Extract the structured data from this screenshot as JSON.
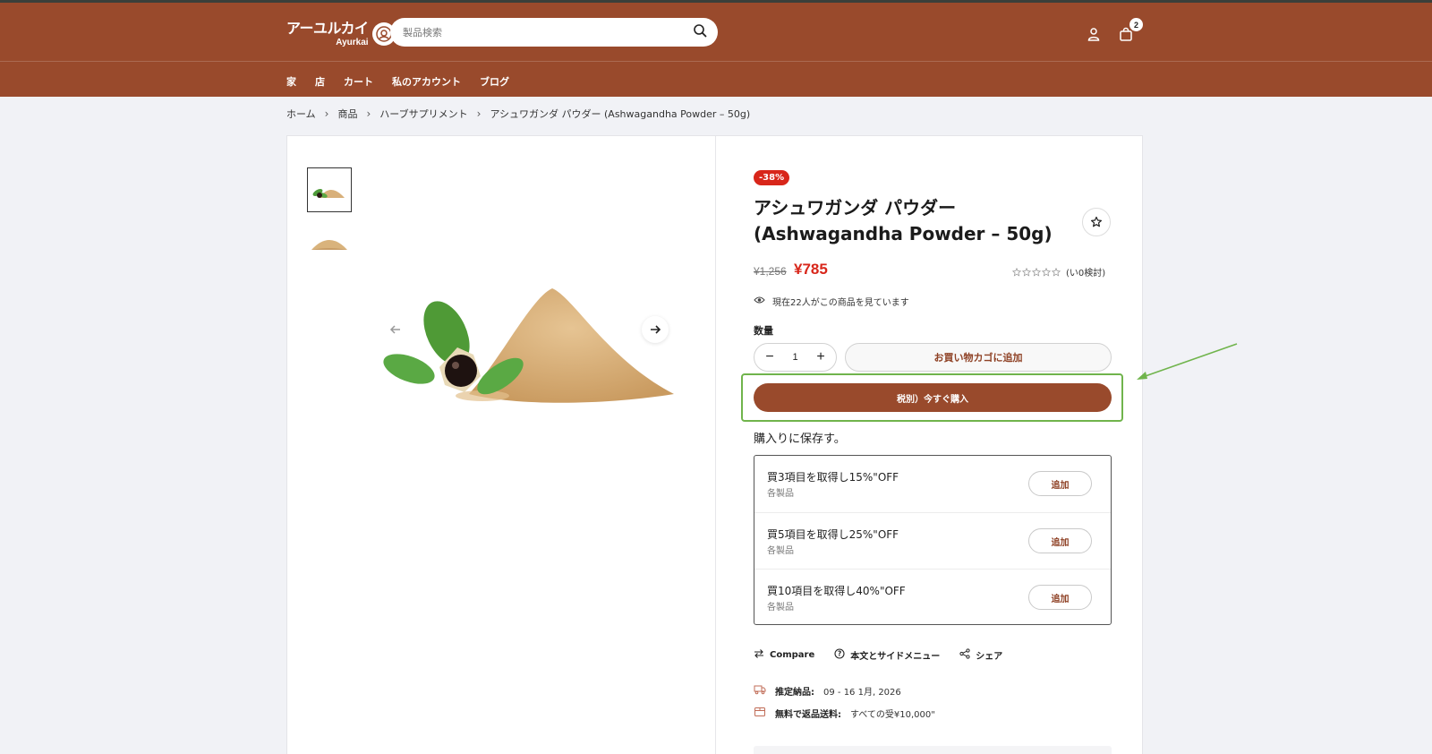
{
  "header": {
    "logo_jp": "アーユルカイ",
    "logo_en": "Ayurkai",
    "search_placeholder": "製品検索",
    "cart_count": "2"
  },
  "nav": [
    "家",
    "店",
    "カート",
    "私のアカウント",
    "ブログ"
  ],
  "breadcrumb": [
    "ホーム",
    "商品",
    "ハーブサプリメント",
    "アシュワガンダ パウダー (Ashwagandha Powder – 50g)"
  ],
  "product": {
    "badge": "-38%",
    "title_line1": "アシュワガンダ パウダー",
    "title_line2": "(Ashwagandha Powder – 50g)",
    "old_price": "¥1,256",
    "new_price": "¥785",
    "reviews": "(い0検討)",
    "viewers": "現在22人がこの商品を見ています",
    "qty_label": "数量",
    "qty_value": "1",
    "add_to_cart": "お買い物カゴに追加",
    "buy_now": "税別）今すぐ購入"
  },
  "bundle": {
    "title": "購入りに保存す。",
    "items": [
      {
        "name": "買3項目を取得し15%\"OFF",
        "sub": "各製品",
        "button": "追加"
      },
      {
        "name": "買5項目を取得し25%\"OFF",
        "sub": "各製品",
        "button": "追加"
      },
      {
        "name": "買10項目を取得し40%\"OFF",
        "sub": "各製品",
        "button": "追加"
      }
    ]
  },
  "actions": {
    "compare": "Compare",
    "question": "本文とサイドメニュー",
    "share": "シェア"
  },
  "shipping": {
    "delivery_label": "推定納品:",
    "delivery_value": "09 - 16 1月, 2026",
    "returns_label": "無料で返品送料:",
    "returns_value": "すべての受¥10,000\""
  },
  "colors": {
    "brand": "#994a2c",
    "sale": "#d8261a",
    "annotation": "#70b44c"
  }
}
